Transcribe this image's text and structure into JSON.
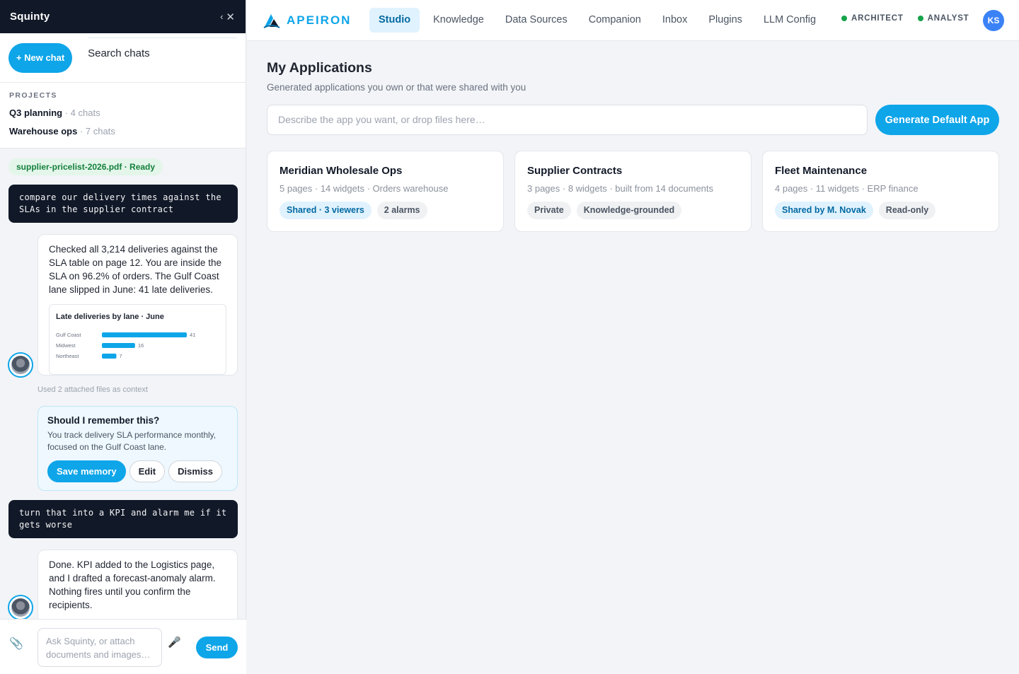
{
  "sidebar": {
    "title": "Squinty",
    "collapse_chevron": "‹",
    "collapse_close": "✕",
    "new_chat": "+ New chat",
    "search_chats": "Search chats",
    "projects_label": "PROJECTS",
    "projects": [
      {
        "name": "Q3 planning",
        "count": " · 4 chats"
      },
      {
        "name": "Warehouse ops",
        "count": " · 7 chats"
      }
    ]
  },
  "chat": {
    "file_pill": "supplier-pricelist-2026.pdf · Ready",
    "messages": [
      {
        "role": "user",
        "text": "compare our delivery times against the SLAs in the supplier contract"
      },
      {
        "role": "assistant",
        "text": "Checked all 3,214 deliveries against the SLA table on page 12. You are inside the SLA on 96.2% of orders. The Gulf Coast lane slipped in June: 41 late deliveries."
      },
      {
        "role": "user",
        "text": "turn that into a KPI and alarm me if it gets worse"
      },
      {
        "role": "assistant",
        "text": "Done. KPI added to the Logistics page, and I drafted a forecast-anomaly alarm. Nothing fires until you confirm the recipients."
      }
    ],
    "used_context": "Used 2 attached files as context",
    "memory": {
      "title": "Should I remember this?",
      "body": "You track delivery SLA performance monthly, focused on the Gulf Coast lane.",
      "save": "Save memory",
      "edit": "Edit",
      "dismiss": "Dismiss"
    },
    "composer": {
      "placeholder": "Ask Squinty, or attach documents and images…",
      "send": "Send"
    }
  },
  "chart_data": {
    "type": "bar",
    "title": "Late deliveries by lane · June",
    "categories": [
      "Gulf Coast",
      "Midwest",
      "Northeast"
    ],
    "values": [
      41,
      16,
      7
    ],
    "orientation": "horizontal",
    "color": "#0ea5e9",
    "xlabel": "",
    "ylabel": ""
  },
  "topbar": {
    "brand": "APEIRON",
    "nav": [
      "Studio",
      "Knowledge",
      "Data Sources",
      "Companion",
      "Inbox",
      "Plugins",
      "LLM Config"
    ],
    "active_nav": "Studio",
    "roles": [
      "ARCHITECT",
      "ANALYST"
    ],
    "user_initials": "KS"
  },
  "main": {
    "title": "My Applications",
    "subtitle": "Generated applications you own or that were shared with you",
    "prompt_placeholder": "Describe the app you want, or drop files here…",
    "generate_button": "Generate Default App",
    "cards": [
      {
        "title": "Meridian Wholesale Ops",
        "meta": "5 pages · 14 widgets · Orders warehouse",
        "tags": [
          {
            "label": "Shared · 3 viewers",
            "style": "blue"
          },
          {
            "label": "2 alarms",
            "style": "gray"
          }
        ]
      },
      {
        "title": "Supplier Contracts",
        "meta": "3 pages · 8 widgets · built from 14 documents",
        "tags": [
          {
            "label": "Private",
            "style": "gray"
          },
          {
            "label": "Knowledge-grounded",
            "style": "gray"
          }
        ]
      },
      {
        "title": "Fleet Maintenance",
        "meta": "4 pages · 11 widgets · ERP finance",
        "tags": [
          {
            "label": "Shared by M. Novak",
            "style": "blue"
          },
          {
            "label": "Read-only",
            "style": "gray"
          }
        ]
      }
    ]
  },
  "colors": {
    "accent": "#0ea5e9",
    "sidebar_header": "#111827",
    "status_green": "#16a34a",
    "avatar": "#3b82f6"
  }
}
